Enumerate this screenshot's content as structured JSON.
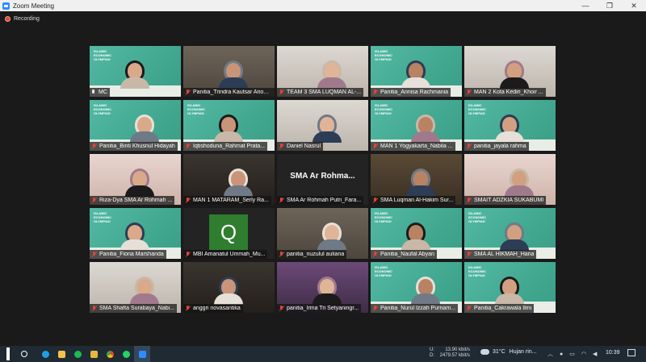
{
  "window": {
    "title": "Zoom Meeting",
    "controls": {
      "minimize": "—",
      "maximize": "❐",
      "close": "✕"
    }
  },
  "recording": {
    "label": "Recording"
  },
  "brand_text": "ISLAMIC ECONOMIC OLYMPIAD",
  "participants": [
    {
      "name": "MC",
      "bg": "green",
      "muted": false,
      "active": true
    },
    {
      "name": "Panitia_Trindra Kautsar Ariobi...",
      "bg": "room",
      "muted": true
    },
    {
      "name": "TEAM 3 SMA LUQMAN AL-...",
      "bg": "light",
      "muted": true
    },
    {
      "name": "Panitia_Annisa Rachmania",
      "bg": "green",
      "muted": true
    },
    {
      "name": "MAN 2 Kota Kediri_Khoir ...",
      "bg": "light",
      "muted": true
    },
    {
      "name": "Panitia_Binti Khusnul Hidayah",
      "bg": "green",
      "muted": true
    },
    {
      "name": "Iqtishoduna_Rahmat Prata...",
      "bg": "green",
      "muted": true
    },
    {
      "name": "Daniel Nasrul",
      "bg": "light",
      "muted": true
    },
    {
      "name": "MAN 1 Yogyakarta_Nabila ...",
      "bg": "green",
      "muted": true
    },
    {
      "name": "panitia_jayala rahma",
      "bg": "green",
      "muted": true
    },
    {
      "name": "Riza-Dya SMA Ar Rohmah ...",
      "bg": "pink",
      "muted": true
    },
    {
      "name": "MAN 1 MATARAM_Serly Ra...",
      "bg": "dark",
      "muted": true
    },
    {
      "name": "SMA Ar Rohmah Putri_Fara...",
      "bg": "black",
      "muted": true,
      "center_title": "SMA Ar Rohma..."
    },
    {
      "name": "SMA Luqman Al-Hakim Sur...",
      "bg": "shelf",
      "muted": true
    },
    {
      "name": "SMAIT ADZKIA SUKABUMI",
      "bg": "pink",
      "muted": true
    },
    {
      "name": "Panitia_Fiona Marshanda",
      "bg": "green",
      "muted": true
    },
    {
      "name": "MBI Amanatul Ummah_Mu...",
      "bg": "black",
      "muted": true,
      "avatar_letter": "Q"
    },
    {
      "name": "panitia_nuzulul auliana",
      "bg": "room",
      "muted": true
    },
    {
      "name": "Panitia_Naufal Abyan",
      "bg": "green",
      "muted": true
    },
    {
      "name": "SMA AL HIKMAH_Hana",
      "bg": "green",
      "muted": true
    },
    {
      "name": "SMA Shafta Surabaya_Nabi...",
      "bg": "light",
      "muted": true
    },
    {
      "name": "anggri novasantika",
      "bg": "dark",
      "muted": true
    },
    {
      "name": "panitia_Irma Tri Setyaningr...",
      "bg": "purple",
      "muted": true
    },
    {
      "name": "Panitia_Nurul Izzah Purnam...",
      "bg": "green",
      "muted": true
    },
    {
      "name": "Panitia_Cakrawala Ilmi",
      "bg": "green",
      "muted": true
    }
  ],
  "taskbar": {
    "net": {
      "up_label": "U:",
      "up_value": "13.90 kbit/s",
      "down_label": "D:",
      "down_value": "2479.57 kbit/s"
    },
    "weather": {
      "temp": "31°C",
      "desc": "Hujan rin..."
    },
    "time": "10:39"
  }
}
